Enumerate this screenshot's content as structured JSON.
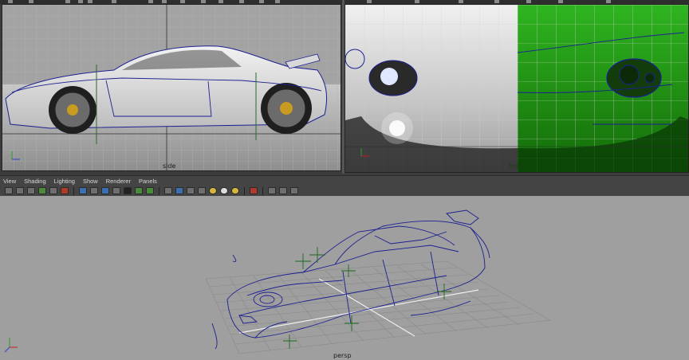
{
  "viewports": {
    "side": {
      "label": "side"
    },
    "front": {
      "label": "front"
    },
    "persp": {
      "label": "persp"
    }
  },
  "menu": [
    "View",
    "Shading",
    "Lighting",
    "Show",
    "Renderer",
    "Panels"
  ],
  "axis": {
    "x": "x",
    "y": "y",
    "z": "z"
  },
  "colors": {
    "viewport_bg": "#9c9c9c",
    "grid": "#b8b8b8",
    "wire": "#1c2090",
    "green_shader": "#1f8a10"
  }
}
